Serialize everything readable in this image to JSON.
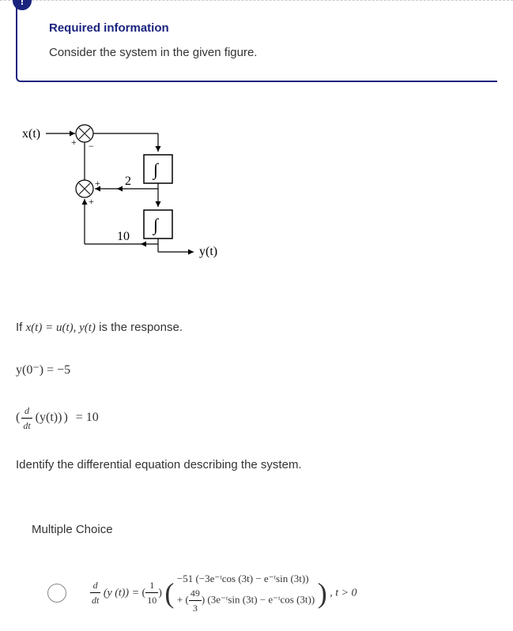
{
  "alert_icon": "!",
  "required": {
    "title": "Required information",
    "desc": "Consider the system in the given figure."
  },
  "diagram": {
    "x_label": "x(t)",
    "y_label": "y(t)",
    "gain1": "2",
    "gain2": "10",
    "int_symbol": "∫",
    "plus": "+",
    "minus": "−"
  },
  "question": {
    "line1_pre": "If ",
    "line1_mid": "x(t) = u(t), y(t)",
    "line1_post": " is the response.",
    "line2": "y(0⁻) = −5",
    "line3_lhs_d": "d",
    "line3_lhs_dt": "dt",
    "line3_lhs_inner": "(y(t))",
    "line3_rhs": " = 10",
    "line4": "Identify the differential equation describing the system."
  },
  "mc_header": "Multiple Choice",
  "choice1": {
    "lhs_d": "d",
    "lhs_dt": "dt",
    "lhs_yt": "(y (t))  =  ",
    "frac1_num": "1",
    "frac1_den": "10",
    "row1": "−51 (−3e⁻ᵗcos (3t) − e⁻ᵗsin (3t))",
    "row2_pre": "+ ",
    "row2_frac_num": "49",
    "row2_frac_den": "3",
    "row2_post": " (3e⁻ᵗsin (3t) − e⁻ᵗcos (3t))",
    "tail": " ,    t > 0"
  }
}
